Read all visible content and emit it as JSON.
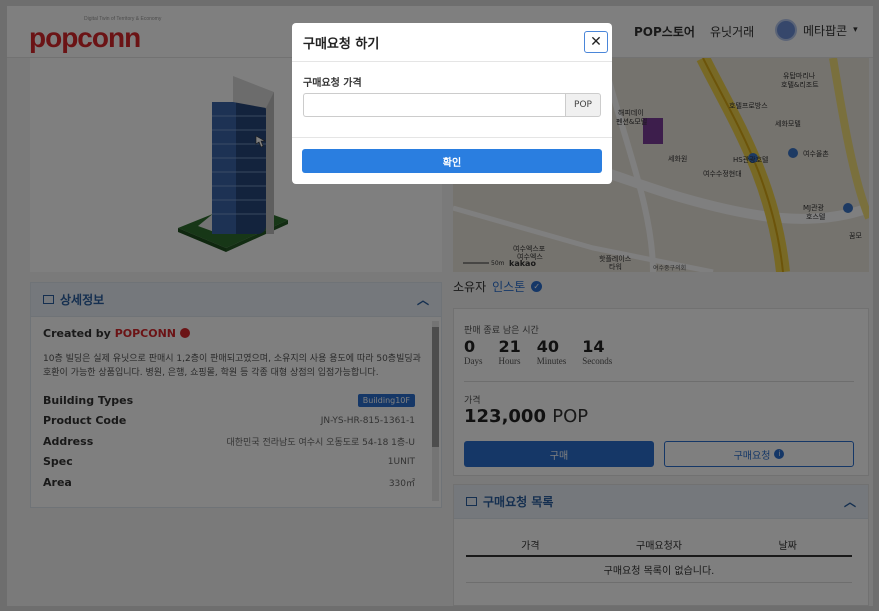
{
  "header": {
    "logo_text": "popconn",
    "logo_tagline": "Digital Twin of Territory & Economy",
    "nav": [
      "POP스토어",
      "유닛거래"
    ],
    "user_name": "메타팝콘",
    "user_caret": "▾"
  },
  "map": {
    "labels": [
      "유탑마리나",
      "호텔&리조트",
      "호텔프로방스",
      "세화모텔",
      "HS관광호텔",
      "여수올촌",
      "해피데이",
      "펜션&모텔",
      "세화원",
      "여수수정현대",
      "MJ관광",
      "호스텔",
      "여수엑스포",
      "여수엑스",
      "핫플레이스",
      "타워",
      "여수중구의회",
      "꿈모",
      "50m",
      "kakao"
    ]
  },
  "owner": {
    "label": "소유자",
    "name": "인스톤"
  },
  "detail": {
    "title": "상세정보",
    "created_by_label": "Created by",
    "created_by": "POPCONN",
    "description": "10층 빌딩은 실제 유닛으로 판매시 1,2층이 판매되고였으며, 소유지의 사용 용도에 따라 50층빌딩과 호환이 가능한 상품입니다. 병원, 은행, 쇼핑몰, 학원 등 각종 대형 상점의 입점가능합니다.",
    "rows": [
      {
        "key": "Building Types",
        "value": "Building10F"
      },
      {
        "key": "Product Code",
        "value": "JN-YS-HR-815-1361-1"
      },
      {
        "key": "Address",
        "value": "대한민국 전라남도 여수시 오동도로 54-18 1층-U"
      },
      {
        "key": "Spec",
        "value": "1UNIT"
      },
      {
        "key": "Area",
        "value": "330㎡"
      }
    ]
  },
  "sale": {
    "remaining_label": "판매 종료 남은 시간",
    "timer": [
      {
        "value": "0",
        "label": "Days"
      },
      {
        "value": "21",
        "label": "Hours"
      },
      {
        "value": "40",
        "label": "Minutes"
      },
      {
        "value": "14",
        "label": "Seconds"
      }
    ],
    "price_label": "가격",
    "price_value": "123,000",
    "price_unit": "POP",
    "buy_label": "구매",
    "request_label": "구매요청"
  },
  "request_list": {
    "title": "구매요청 목록",
    "columns": [
      "가격",
      "구매요청자",
      "날짜"
    ],
    "empty_text": "구매요청 목록이 없습니다."
  },
  "modal": {
    "title": "구매요청 하기",
    "close_glyph": "✕",
    "field_label": "구매요청 가격",
    "input_value": "",
    "input_placeholder": "",
    "input_addon": "POP",
    "confirm_label": "확인"
  },
  "colors": {
    "brand_red": "#d6262b",
    "primary_blue": "#2a7ee0",
    "overlay": "rgba(0,0,0,0.5)"
  }
}
